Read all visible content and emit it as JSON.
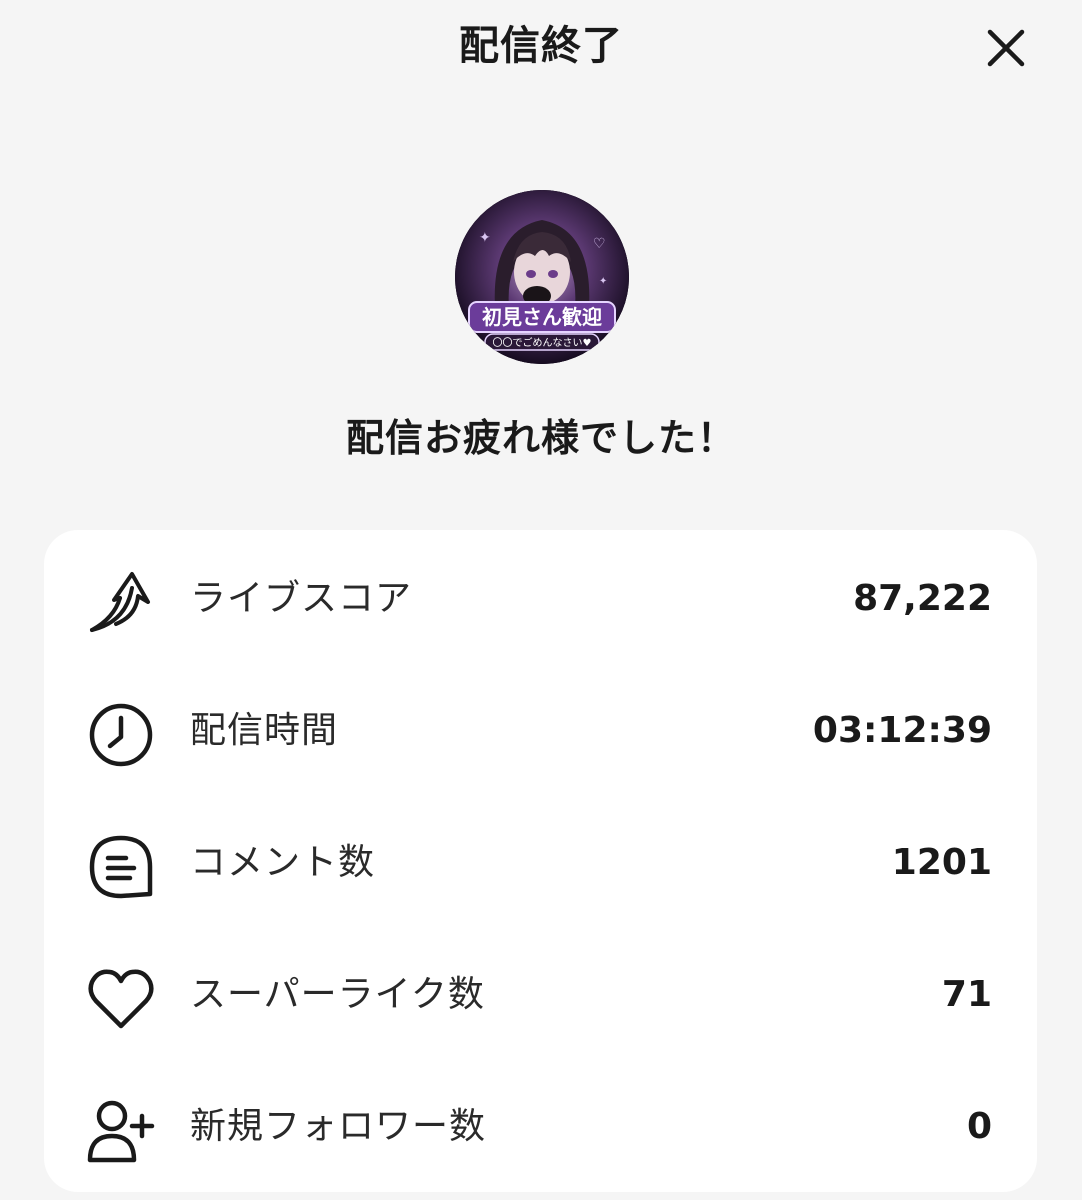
{
  "header": {
    "title": "配信終了",
    "close_icon": "close-icon"
  },
  "avatar": {
    "caption_main": "初見さん歓迎",
    "caption_sub": "〇〇でごめんなさい♥"
  },
  "farewell_message": "配信お疲れ様でした！",
  "stats": [
    {
      "icon": "arrow-up-curve-icon",
      "label": "ライブスコア",
      "value": "87,222"
    },
    {
      "icon": "clock-icon",
      "label": "配信時間",
      "value": "03:12:39"
    },
    {
      "icon": "comment-icon",
      "label": "コメント数",
      "value": "1201"
    },
    {
      "icon": "heart-icon",
      "label": "スーパーライク数",
      "value": "71"
    },
    {
      "icon": "user-plus-icon",
      "label": "新規フォロワー数",
      "value": "0"
    }
  ]
}
